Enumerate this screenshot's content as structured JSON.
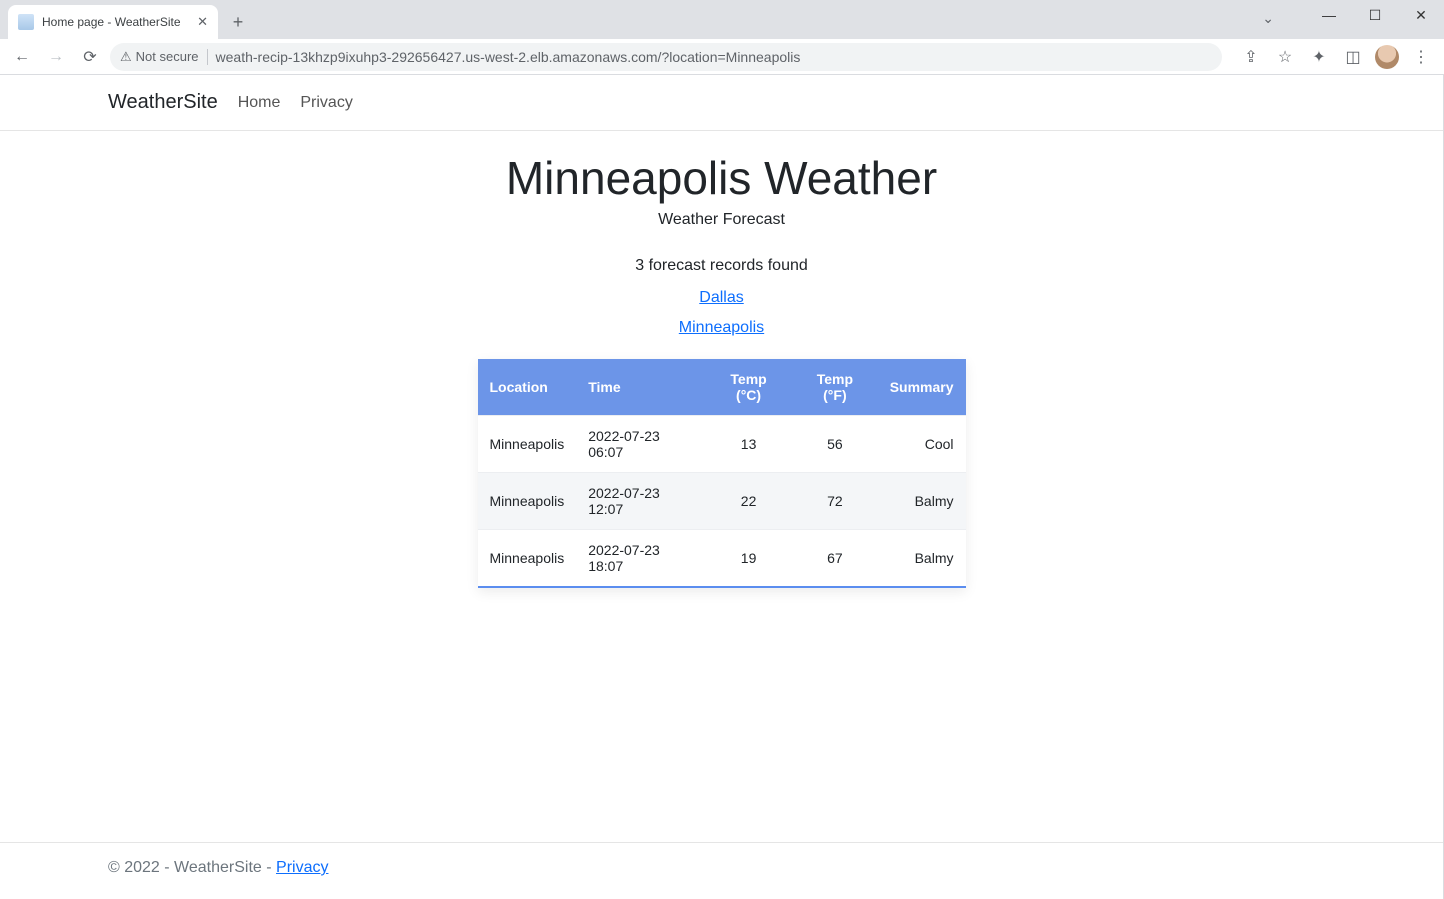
{
  "browser": {
    "tab_title": "Home page - WeatherSite",
    "url": "weath-recip-13khzp9ixuhp3-292656427.us-west-2.elb.amazonaws.com/?location=Minneapolis",
    "security_label": "Not secure"
  },
  "navbar": {
    "brand": "WeatherSite",
    "links": [
      "Home",
      "Privacy"
    ]
  },
  "page": {
    "heading": "Minneapolis Weather",
    "subtitle": "Weather Forecast",
    "records_found": "3 forecast records found",
    "location_links": [
      "Dallas",
      "Minneapolis"
    ]
  },
  "table": {
    "columns": [
      "Location",
      "Time",
      "Temp (°C)",
      "Temp (°F)",
      "Summary"
    ],
    "rows": [
      {
        "location": "Minneapolis",
        "time": "2022-07-23 06:07",
        "temp_c": "13",
        "temp_f": "56",
        "summary": "Cool"
      },
      {
        "location": "Minneapolis",
        "time": "2022-07-23 12:07",
        "temp_c": "22",
        "temp_f": "72",
        "summary": "Balmy"
      },
      {
        "location": "Minneapolis",
        "time": "2022-07-23 18:07",
        "temp_c": "19",
        "temp_f": "67",
        "summary": "Balmy"
      }
    ]
  },
  "footer": {
    "copyright": "© 2022 - WeatherSite - ",
    "privacy": "Privacy"
  }
}
